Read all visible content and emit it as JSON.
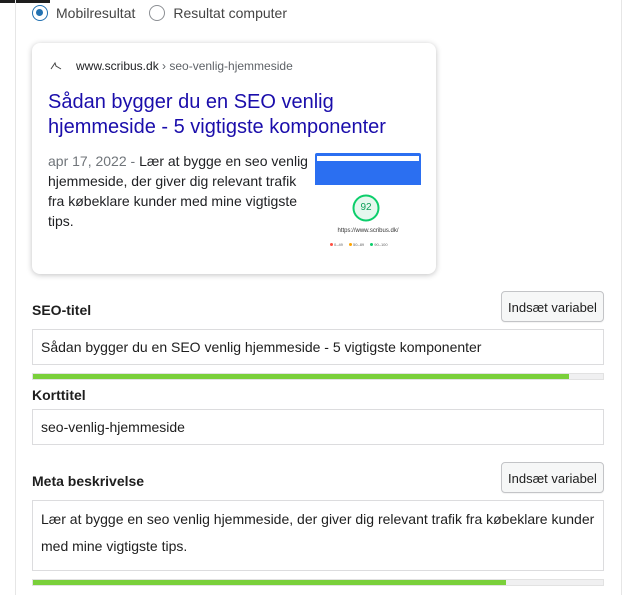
{
  "preview_mode": {
    "options": [
      {
        "label": "Mobilresultat",
        "checked": true
      },
      {
        "label": "Resultat computer",
        "checked": false
      }
    ]
  },
  "serp": {
    "favicon": "scribus-favicon",
    "domain": "www.scribus.dk",
    "breadcrumb": " › seo-venlig-hjemmeside",
    "title": "Sådan bygger du en SEO venlig hjemmeside - 5 vigtigste komponenter",
    "date": "apr 17, 2022",
    "separator": " - ",
    "snippet": "Lær at bygge en seo venlig hjemmeside, der giver dig relevant trafik fra købeklare kunder med mine vigtigste tips.",
    "thumbnail": {
      "score": "92",
      "url": "https://www.scribus.dk/",
      "legend": [
        "0–49",
        "50–89",
        "90–100"
      ],
      "colors": {
        "bar": "#2b6ff1",
        "gauge": "#0cce6b"
      }
    }
  },
  "seo_title": {
    "label": "SEO-titel",
    "insert_button": "Indsæt variabel",
    "value": "Sådan bygger du en SEO venlig hjemmeside - 5 vigtigste komponenter",
    "progress": 0.94
  },
  "slug": {
    "label": "Korttitel",
    "value": "seo-venlig-hjemmeside"
  },
  "meta_description": {
    "label": "Meta beskrivelse",
    "insert_button": "Indsæt variabel",
    "value": "Lær at bygge en seo venlig hjemmeside, der giver dig relevant trafik fra købeklare kunder med mine vigtigste tips.",
    "progress": 0.83
  },
  "colors": {
    "accent": "#2271b1",
    "link": "#1a0dab",
    "progress_good": "#7ad03a"
  }
}
